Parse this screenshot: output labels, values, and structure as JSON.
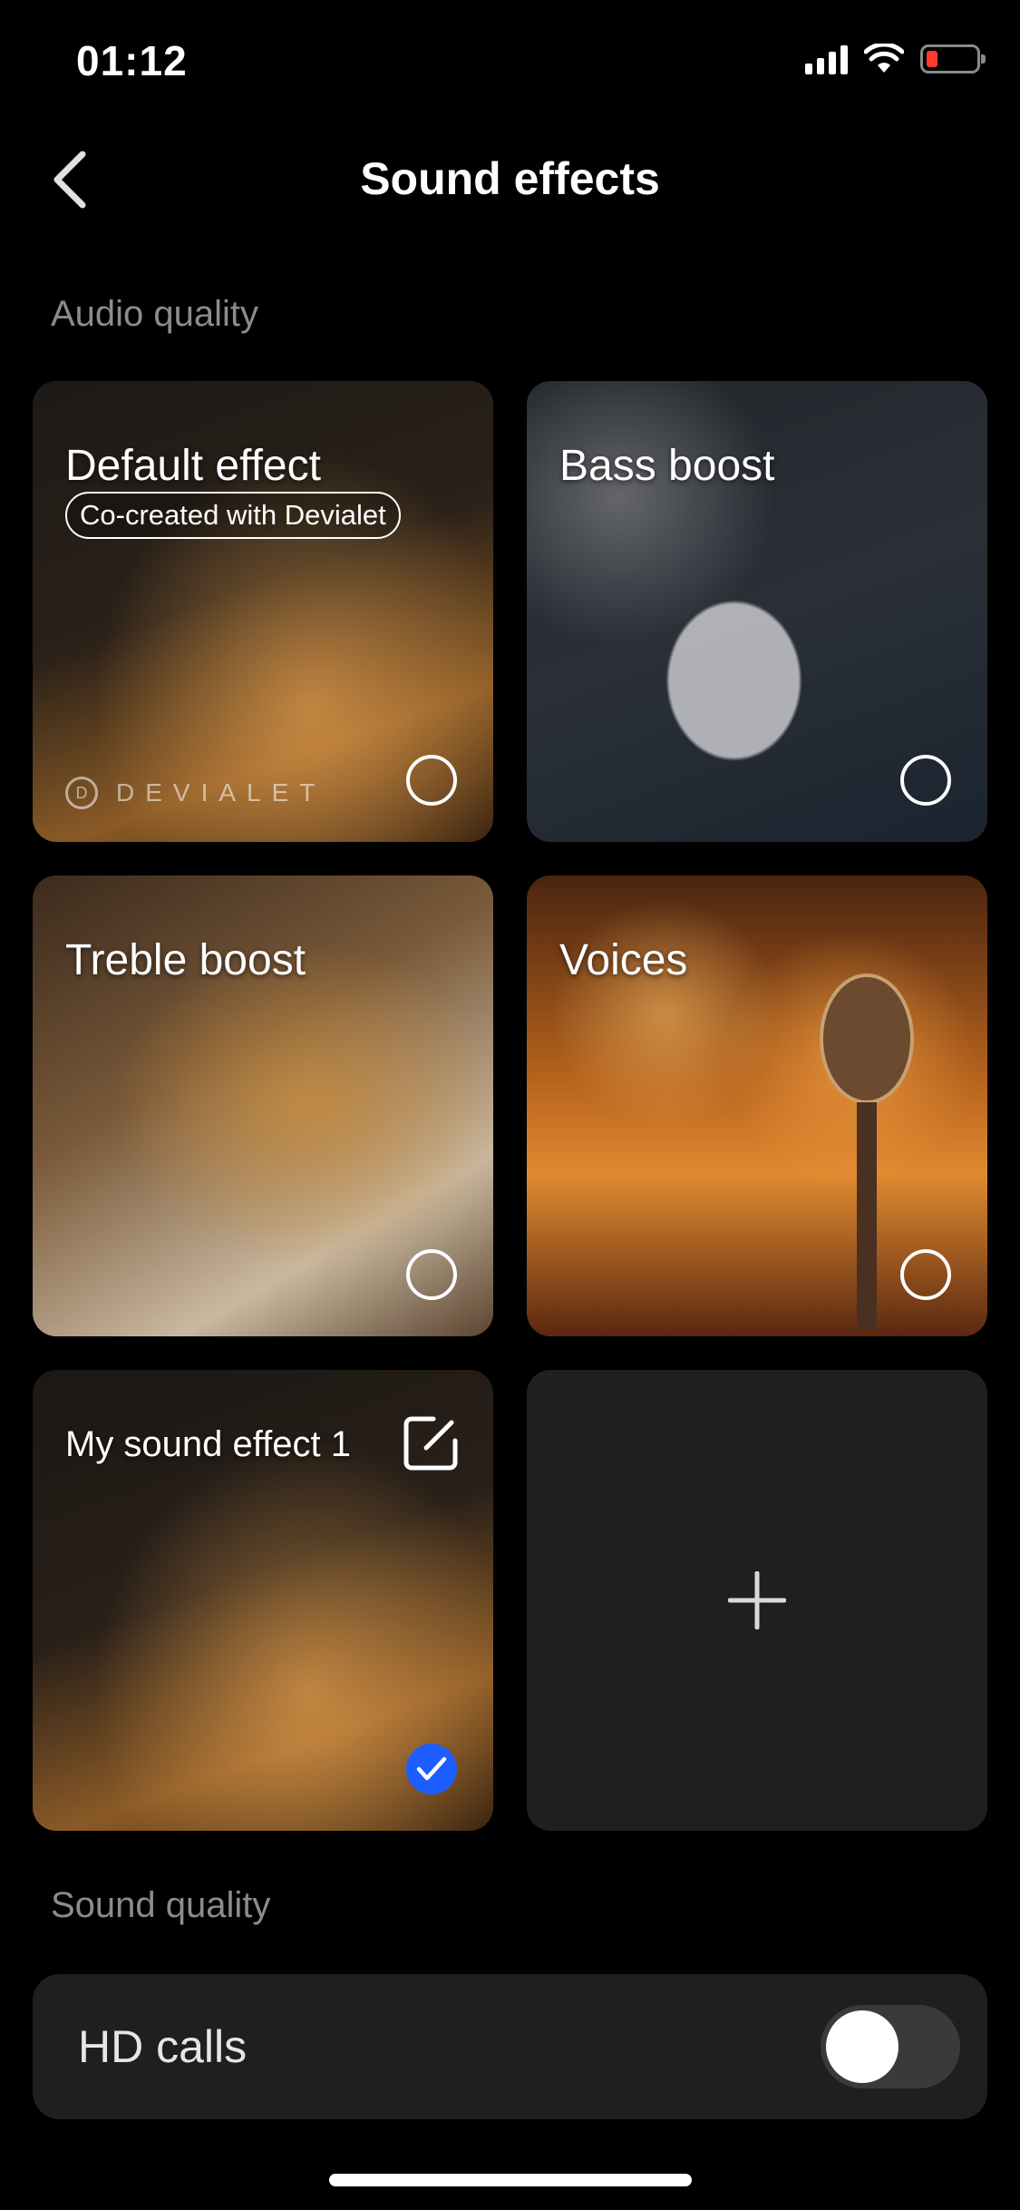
{
  "status_bar": {
    "time": "01:12",
    "battery_color": "#ff3b30"
  },
  "header": {
    "title": "Sound effects",
    "back_icon": "chevron-left-icon"
  },
  "sections": {
    "audio_quality": "Audio quality",
    "sound_quality": "Sound quality"
  },
  "cards": [
    {
      "title": "Default effect",
      "badge": "Co-created with Devialet",
      "brand": "DEVIALET",
      "brand_mark": "D",
      "selected": false
    },
    {
      "title": "Bass boost",
      "selected": false
    },
    {
      "title": "Treble boost",
      "selected": false
    },
    {
      "title": "Voices",
      "selected": false
    },
    {
      "title": "My sound effect 1",
      "selected": true,
      "edit_icon": "edit-icon"
    }
  ],
  "add_card": {
    "icon": "plus-icon"
  },
  "settings": [
    {
      "label": "HD calls",
      "enabled": false
    }
  ],
  "accent_color": "#1e5eff"
}
